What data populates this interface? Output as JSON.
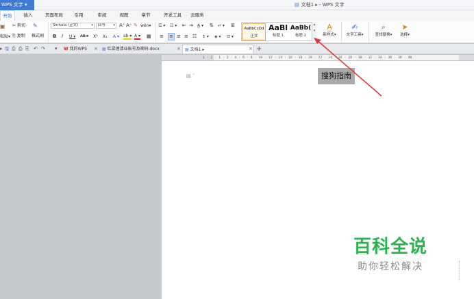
{
  "titlebar": {
    "app_menu": "WPS 文字 ▾",
    "doc_title": "文档1 ▸ - WPS 文字",
    "doc_icon": "document-icon"
  },
  "menu": {
    "tabs": [
      "开始",
      "插入",
      "页面布局",
      "引用",
      "审阅",
      "视图",
      "章节",
      "开发工具",
      "云服务"
    ],
    "active": "开始"
  },
  "ribbon": {
    "clipboard": {
      "paste": "粘贴▾",
      "cut": "剪切",
      "copy": "复制",
      "format_painter": "格式刷"
    },
    "font": {
      "family": "Sinhala (正文)",
      "size": "四号",
      "grow": "A⁺",
      "shrink": "A⁻",
      "clear": "✎",
      "phonetic": "wén▾",
      "bold": "B",
      "italic": "I",
      "underline": "U ▾",
      "strike": "AB ▾",
      "superscript": "X²",
      "subscript": "X₂",
      "text_effect": "A ▾",
      "highlight": "ab ▾",
      "font_color": "A ▾",
      "char_border": "▦"
    },
    "paragraph": {
      "bullets": "☰ ▾",
      "numbering": "☷ ▾",
      "outdent": "⇤",
      "indent": "⇥",
      "text_dir": "A̲ ▾",
      "sort": "⇅",
      "show_marks": "↵ ▾",
      "table": "⊞",
      "align_left": "≡",
      "align_center": "≡",
      "align_right": "≡",
      "justify": "≡",
      "distribute": "☷",
      "line_spacing": "↕ ▾",
      "shading": "◈ ▾",
      "borders": "⊡ ▾"
    },
    "styles": [
      {
        "preview": "AaBbCcDd",
        "name": "正文"
      },
      {
        "preview": "AaBl",
        "name": "标题 1"
      },
      {
        "preview": "AaBb(",
        "name": "标题 2"
      }
    ],
    "gallery_scroll": "▴ ▾",
    "new_style": "新样式▾",
    "text_tools": "文字工具▾",
    "find_replace": "查找替换▾",
    "select": "选择▾"
  },
  "tabbar": {
    "quick_access": [
      "▸",
      "🖫",
      "⎙",
      "⎙",
      "⎘",
      "↶",
      "↷",
      "▾"
    ],
    "tabs": [
      {
        "label": "我的WPS",
        "icon": "wps-logo-icon"
      },
      {
        "label": "红梁理清业账号及密码.docx",
        "icon": "document-icon"
      },
      {
        "label": "文档1 ▸",
        "icon": "document-icon"
      }
    ],
    "close": "×",
    "add": "+"
  },
  "ruler": {
    "labels": "1 · 2 · 1 · 2 · 4 · 6 · 8 · 10 · 12 · 14 · 16 · 18 · 20 · 22 · 24 · 26 · 28 · 30 · 32 · 34 · 36 · 38 · 40"
  },
  "document": {
    "selected_text": "搜狗指南"
  },
  "watermark": {
    "title": "百科全说",
    "subtitle": "助你轻松解决"
  },
  "colors": {
    "accent": "#3d7bd5",
    "watermark_green": "#2bb350",
    "arrow": "#e03a3a"
  }
}
